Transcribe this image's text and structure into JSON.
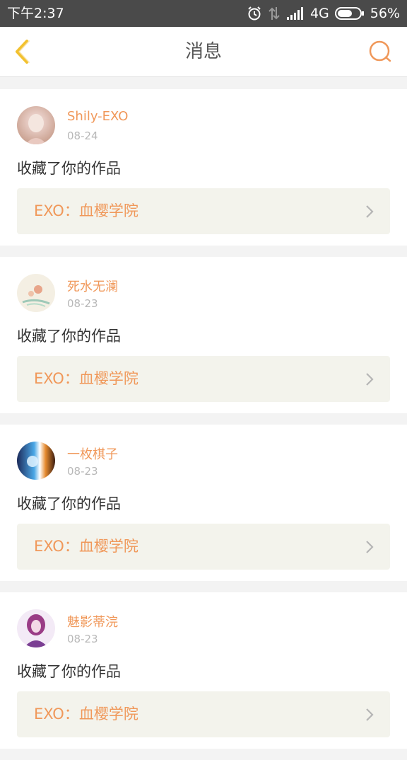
{
  "status_bar": {
    "time": "下午2:37",
    "network": "4G",
    "battery": "56%",
    "icons": [
      "alarm-icon",
      "data-transfer-icon",
      "signal-icon",
      "battery-icon"
    ]
  },
  "header": {
    "title": "消息",
    "back_icon": "chevron-left-icon",
    "search_icon": "search-icon",
    "accent_color": "#f0985a"
  },
  "messages": [
    {
      "user": "Shily-EXO",
      "date": "08-24",
      "action": "收藏了你的作品",
      "work": "EXO：血樱学院",
      "avatar_colors": [
        "#f7e3e0",
        "#d9b8a6"
      ]
    },
    {
      "user": "死水无澜",
      "date": "08-23",
      "action": "收藏了你的作品",
      "work": "EXO：血樱学院",
      "avatar_colors": [
        "#f6efe4",
        "#e9a48a"
      ]
    },
    {
      "user": "一枚棋子",
      "date": "08-23",
      "action": "收藏了你的作品",
      "work": "EXO：血樱学院",
      "avatar_colors": [
        "#2a3b6e",
        "#e0732e"
      ]
    },
    {
      "user": "魅影蒂浣",
      "date": "08-23",
      "action": "收藏了你的作品",
      "work": "EXO：血樱学院",
      "avatar_colors": [
        "#e8d6ee",
        "#8a3f7c"
      ]
    }
  ]
}
